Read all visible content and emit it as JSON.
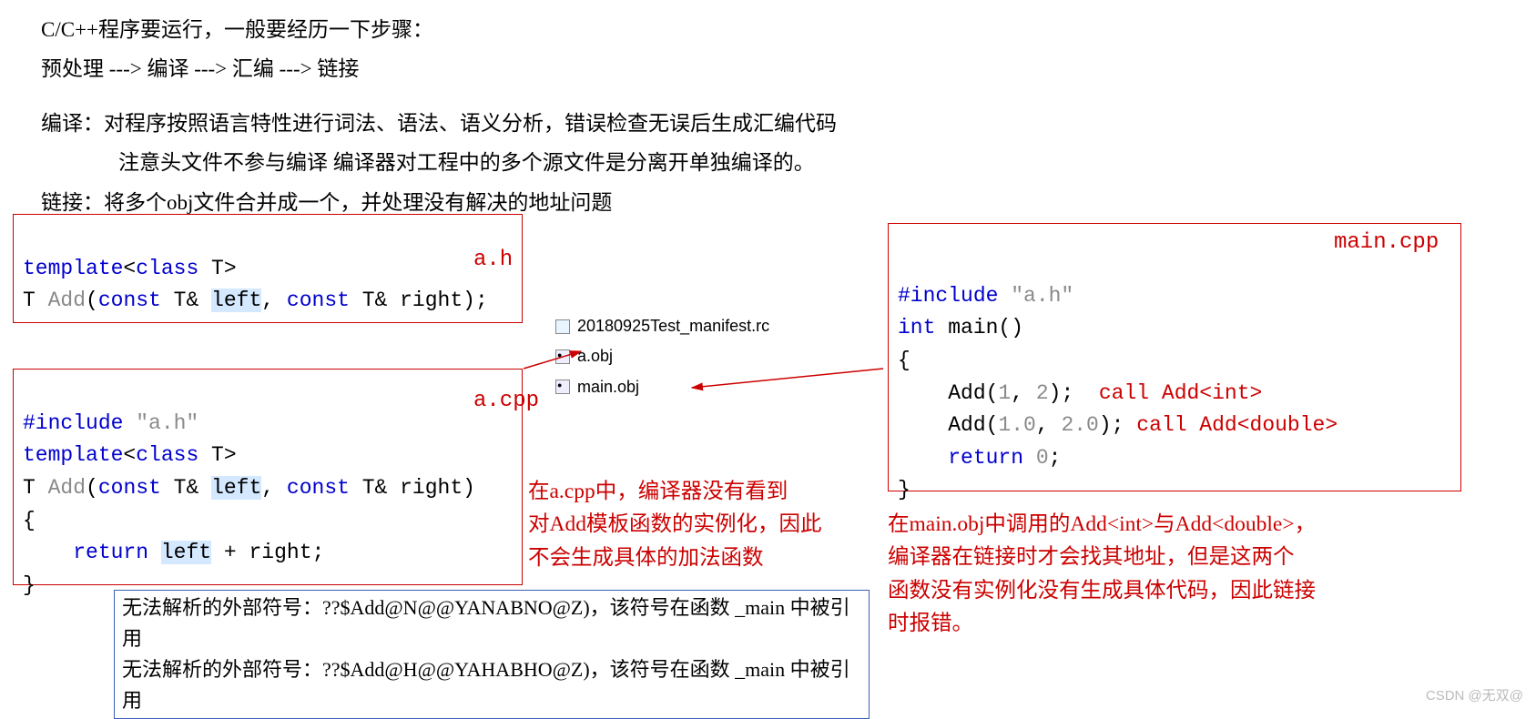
{
  "intro": {
    "line1": "C/C++程序要运行，一般要经历一下步骤：",
    "line2": "预处理 ---> 编译 ---> 汇编 ---> 链接",
    "line3": "编译：对程序按照语言特性进行词法、语法、语义分析，错误检查无误后生成汇编代码",
    "line4": "注意头文件不参与编译 编译器对工程中的多个源文件是分离开单独编译的。",
    "line5": "链接：将多个obj文件合并成一个，并处理没有解决的地址问题"
  },
  "labels": {
    "ah": "a.h",
    "acpp": "a.cpp",
    "main": "main.cpp"
  },
  "ah_code": {
    "l1_a": "template",
    "l1_b": "<",
    "l1_c": "class",
    "l1_d": " T>",
    "l2_a": "T ",
    "l2_b": "Add",
    "l2_c": "(",
    "l2_d": "const",
    "l2_e": " T& ",
    "l2_f": "left",
    "l2_g": ", ",
    "l2_h": "const",
    "l2_i": " T& right);"
  },
  "acpp_code": {
    "l1_a": "#include",
    "l1_b": " \"a.h\"",
    "l2_a": "template",
    "l2_b": "<",
    "l2_c": "class",
    "l2_d": " T>",
    "l3_a": "T ",
    "l3_b": "Add",
    "l3_c": "(",
    "l3_d": "const",
    "l3_e": " T& ",
    "l3_f": "left",
    "l3_g": ", ",
    "l3_h": "const",
    "l3_i": " T& right)",
    "l4": "{",
    "l5_a": "    ",
    "l5_b": "return",
    "l5_c": " ",
    "l5_d": "left",
    "l5_e": " + right;",
    "l6": "}"
  },
  "main_code": {
    "l1_a": "#include",
    "l1_b": " \"a.h\"",
    "l2_a": "int",
    "l2_b": " main()",
    "l3": "{",
    "l4_a": "    Add(",
    "l4_b": "1",
    "l4_c": ", ",
    "l4_d": "2",
    "l4_e": ");  ",
    "l4_f": "call Add<int>",
    "l5_a": "    Add(",
    "l5_b": "1.0",
    "l5_c": ", ",
    "l5_d": "2.0",
    "l5_e": "); ",
    "l5_f": "call Add<double>",
    "l6_a": "    ",
    "l6_b": "return",
    "l6_c": " ",
    "l6_d": "0",
    "l6_e": ";",
    "l7": "}"
  },
  "files": {
    "f1": "20180925Test_manifest.rc",
    "f2": "a.obj",
    "f3": "main.obj"
  },
  "annot": {
    "a_cpp_1": "在a.cpp中，编译器没有看到",
    "a_cpp_2": "对Add模板函数的实例化，因此",
    "a_cpp_3": "不会生成具体的加法函数",
    "main_1": "在main.obj中调用的Add<int>与Add<double>，",
    "main_2": "编译器在链接时才会找其地址，但是这两个",
    "main_3": "函数没有实例化没有生成具体代码，因此链接",
    "main_4": "时报错。"
  },
  "errors": {
    "e1": "无法解析的外部符号：??$Add@N@@YANABNO@Z)，该符号在函数 _main 中被引用",
    "e2": "无法解析的外部符号：??$Add@H@@YAHABHO@Z)，该符号在函数 _main 中被引用"
  },
  "watermark": "CSDN @无双@"
}
